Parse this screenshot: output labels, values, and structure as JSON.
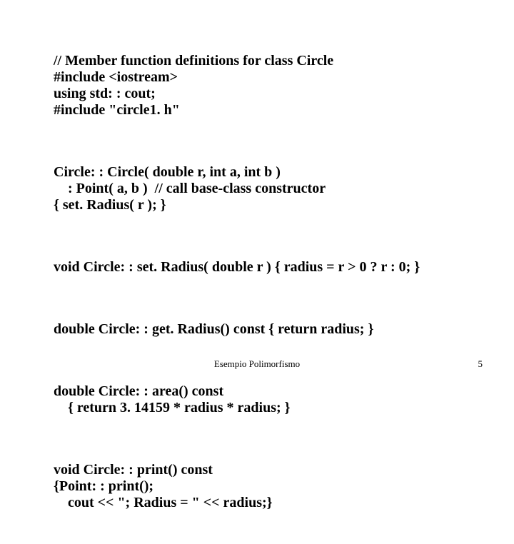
{
  "code": {
    "block1": "// Member function definitions for class Circle\n#include <iostream>\nusing std: : cout;\n#include \"circle1. h\"",
    "block2": "Circle: : Circle( double r, int a, int b )\n    : Point( a, b )  // call base-class constructor\n{ set. Radius( r ); }",
    "block3": "void Circle: : set. Radius( double r ) { radius = r > 0 ? r : 0; }",
    "block4": "double Circle: : get. Radius() const { return radius; }",
    "block5": "double Circle: : area() const\n    { return 3. 14159 * radius * radius; }",
    "block6": "void Circle: : print() const\n{Point: : print();\n    cout << \"; Radius = \" << radius;}"
  },
  "footer": {
    "center": "Esempio Polimorfismo",
    "page": "5"
  }
}
